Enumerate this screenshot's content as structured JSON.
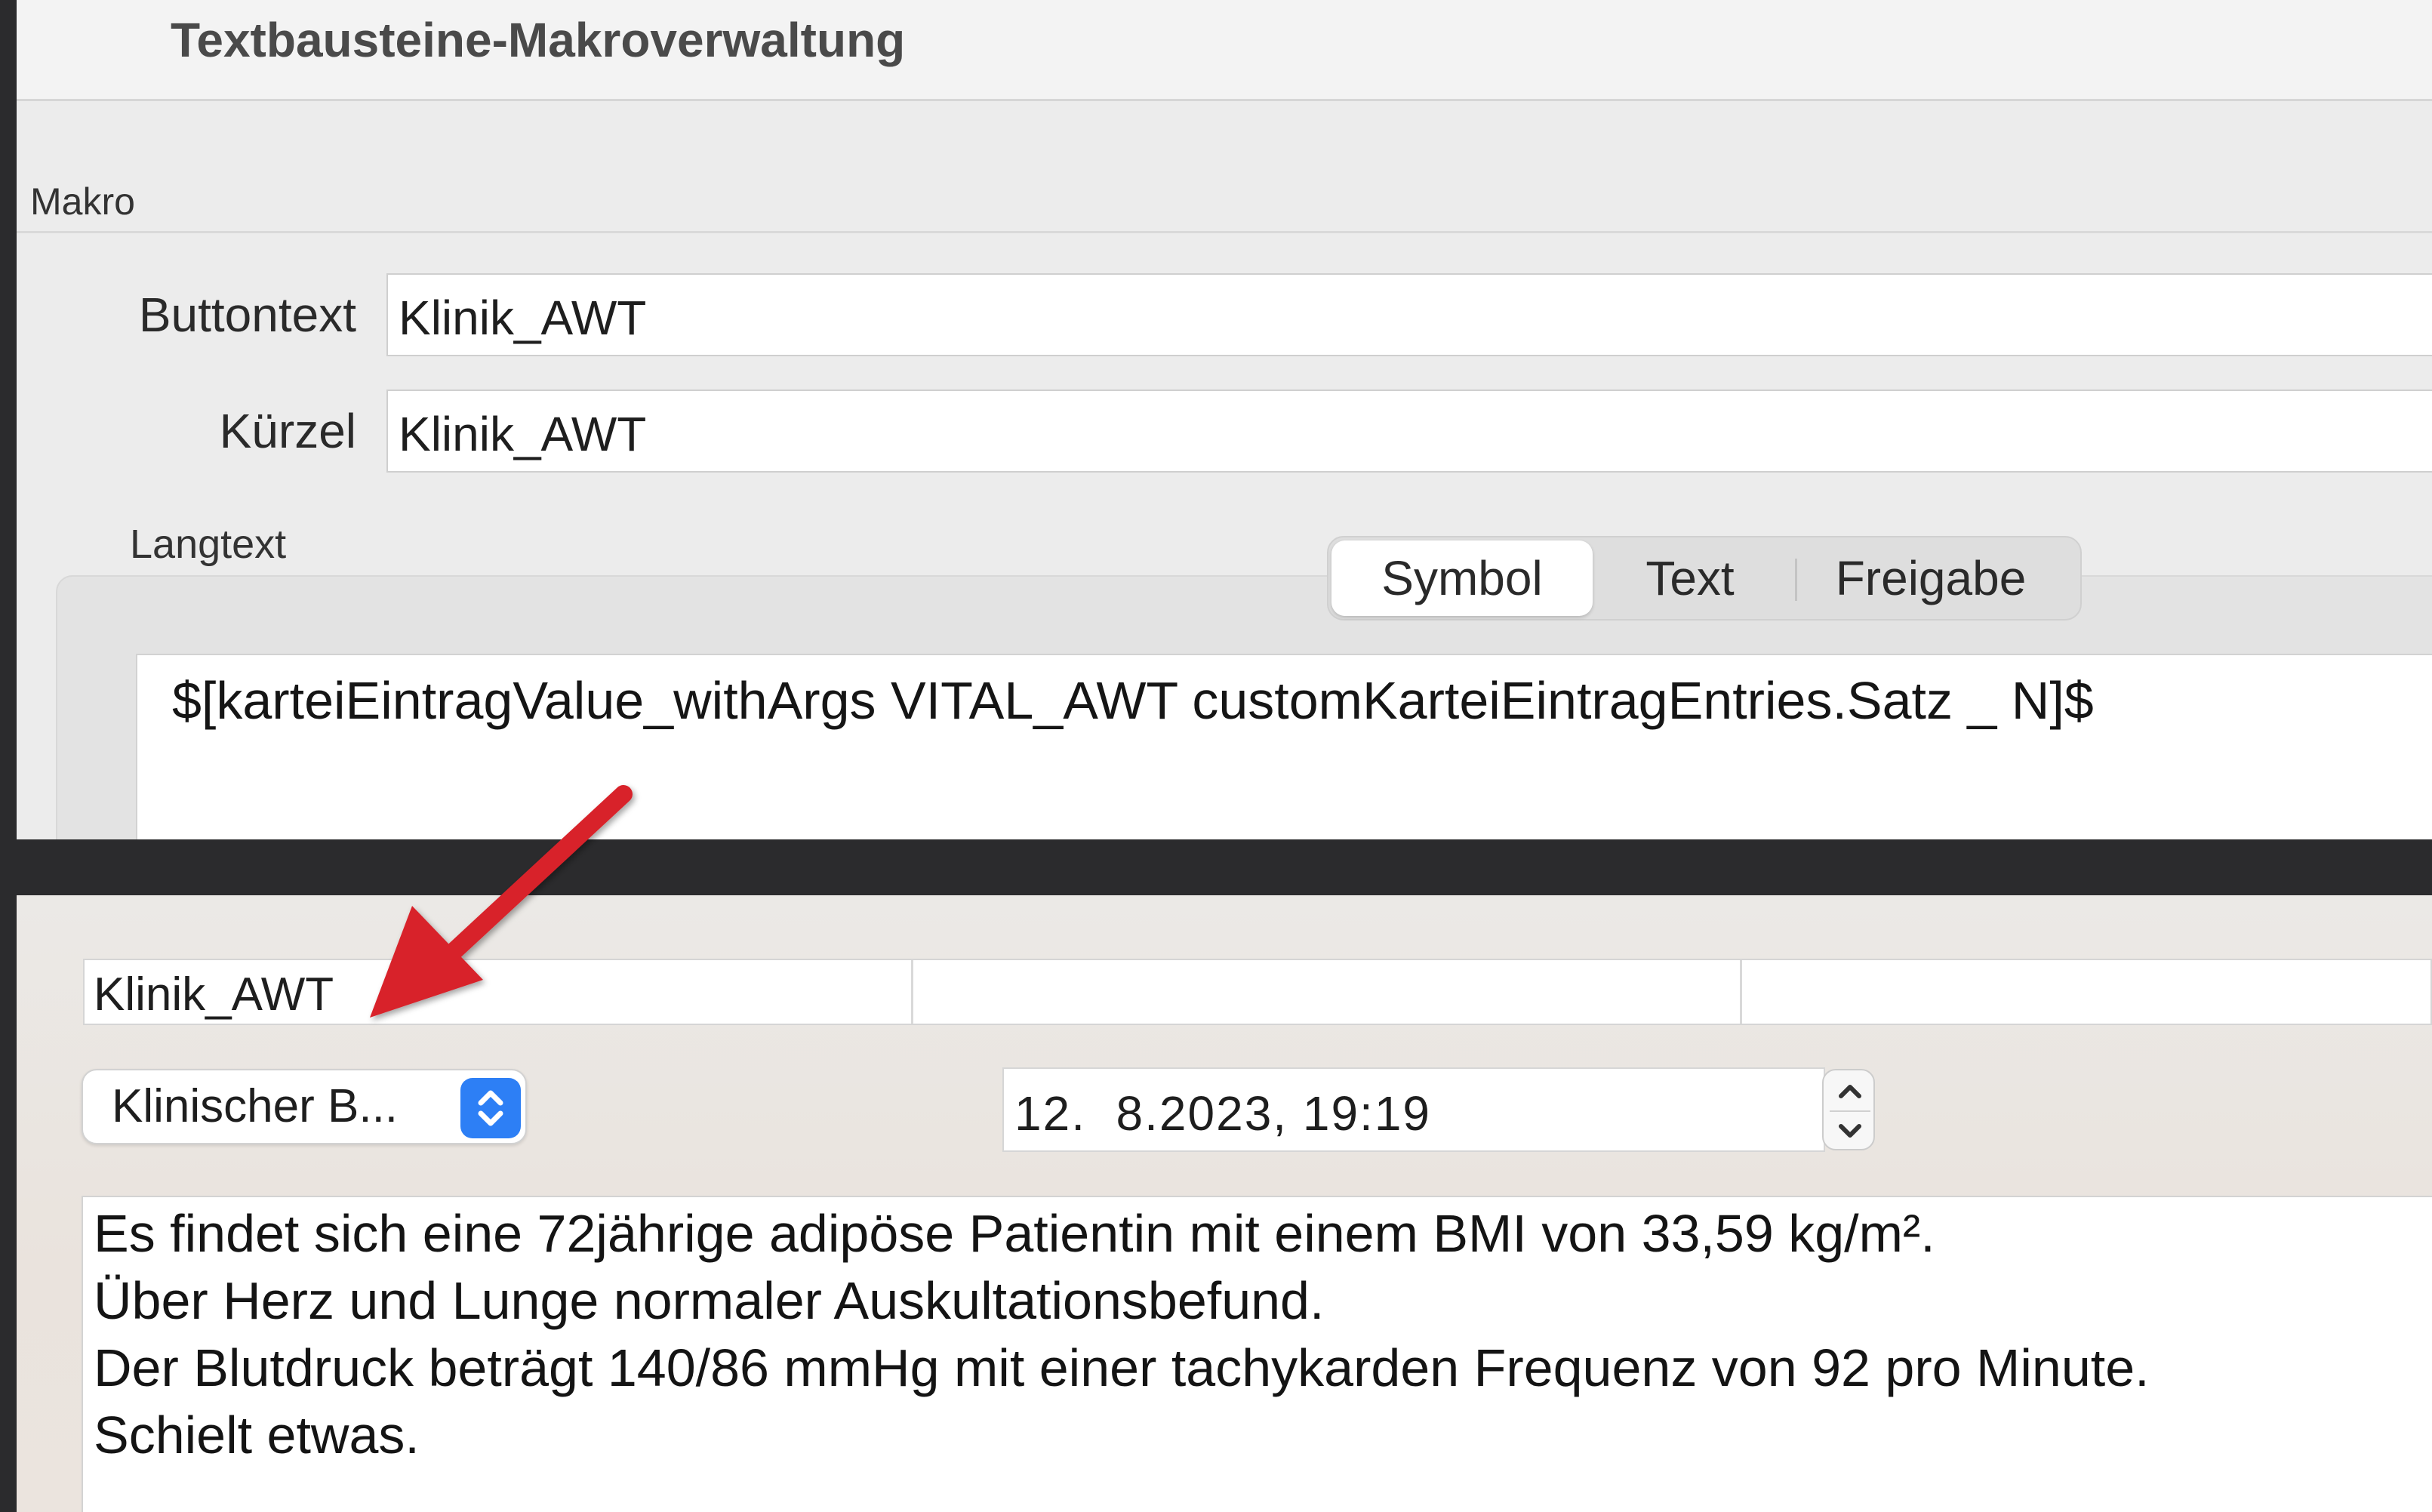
{
  "dialog": {
    "title": "Textbausteine-Makroverwaltung",
    "section_label": "Makro",
    "buttontext": {
      "label": "Buttontext",
      "value": "Klinik_AWT"
    },
    "kuerzel": {
      "label": "Kürzel",
      "value": "Klinik_AWT"
    },
    "langtext": {
      "label": "Langtext",
      "tabs": [
        {
          "label": "Symbol",
          "selected": true
        },
        {
          "label": "Text",
          "selected": false
        },
        {
          "label": "Freigabe",
          "selected": false
        }
      ],
      "content": "$[karteiEintragValue_withArgs VITAL_AWT customKarteiEintragEntries.Satz _ N]$"
    }
  },
  "entry": {
    "row_label": "Klinik_AWT",
    "category_popup": {
      "value": "Klinischer  B...",
      "icon": "updown-chevron-icon"
    },
    "datetime": "12.  8.2023, 19:19",
    "stepper_icon": "stepper-icon",
    "report_lines": [
      "Es findet sich eine 72jährige adipöse Patientin mit einem BMI von 33,59 kg/m².",
      "Über Herz und Lunge normaler Auskultationsbefund.",
      "Der Blutdruck beträgt 140/86 mmHg mit einer tachykarden Frequenz von 92 pro Minute.",
      "Schielt etwas."
    ]
  },
  "annotation": {
    "icon": "red-arrow-icon",
    "color": "#d8232a"
  },
  "colors": {
    "accent": "#2d7ff5",
    "background": "#2b2b2d",
    "panel": "#ececec"
  }
}
